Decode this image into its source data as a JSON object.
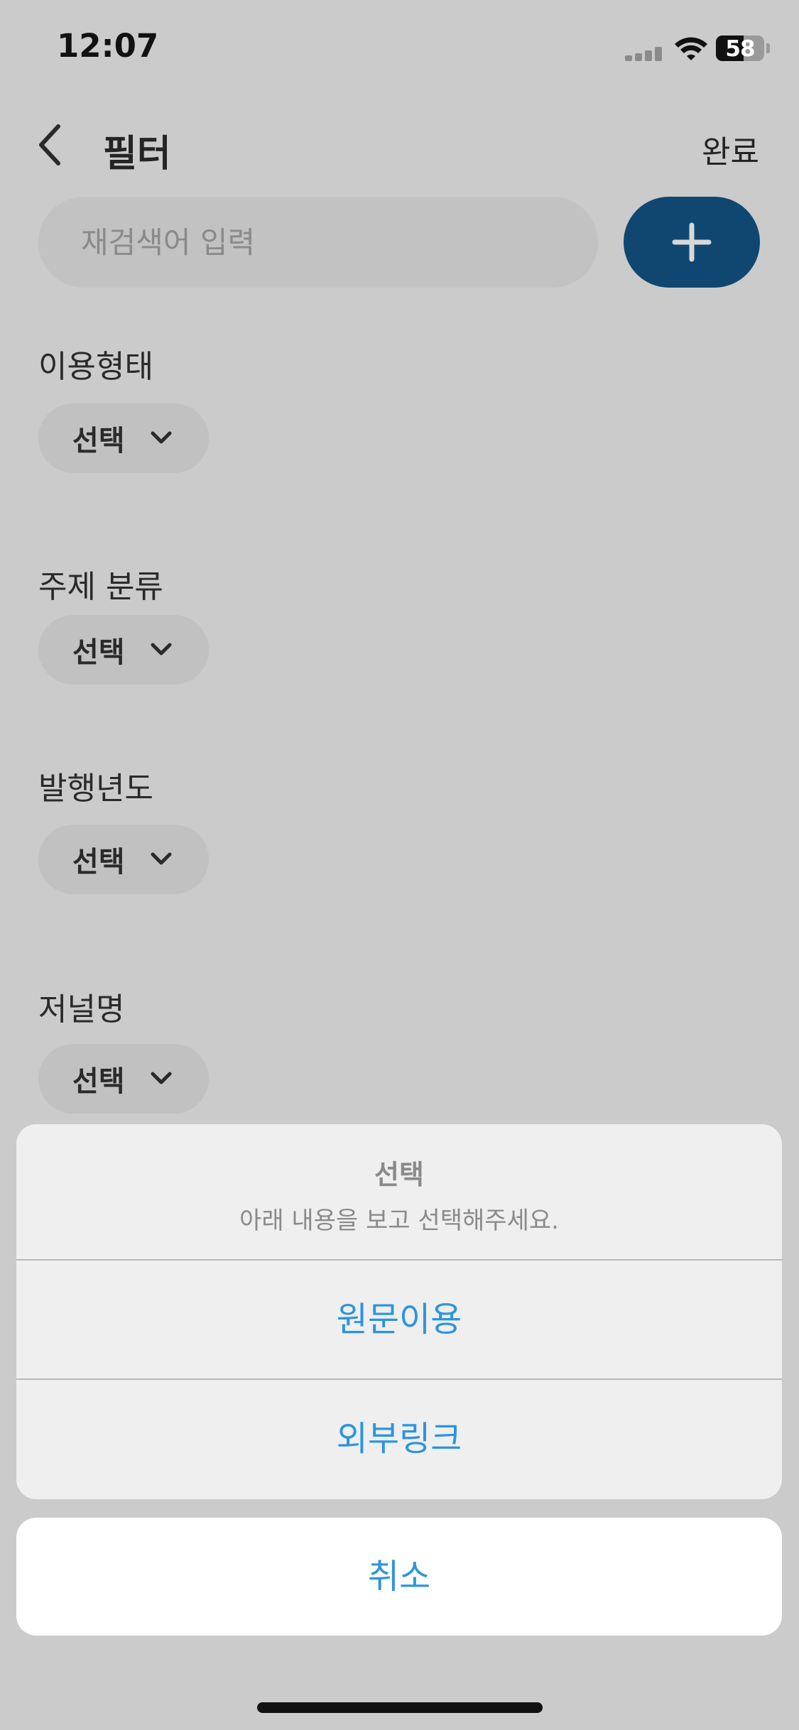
{
  "status_bar": {
    "time": "12:07",
    "battery_level": "58",
    "icons": [
      "signal-icon",
      "wifi-icon",
      "battery-icon"
    ]
  },
  "header": {
    "title": "필터",
    "done_label": "완료",
    "back_icon": "chevron-left-icon"
  },
  "search": {
    "placeholder": "재검색어 입력",
    "value": "",
    "add_icon": "plus-icon"
  },
  "filters": [
    {
      "label": "이용형태",
      "value": "선택"
    },
    {
      "label": "주제 분류",
      "value": "선택"
    },
    {
      "label": "발행년도",
      "value": "선택"
    },
    {
      "label": "저널명",
      "value": "선택"
    }
  ],
  "action_sheet": {
    "title": "선택",
    "message": "아래 내용을 보고 선택해주세요.",
    "options": [
      "원문이용",
      "외부링크"
    ],
    "cancel_label": "취소"
  },
  "colors": {
    "accent": "#0f4771",
    "link": "#2f94db",
    "backdrop": "#cbcbcb"
  }
}
